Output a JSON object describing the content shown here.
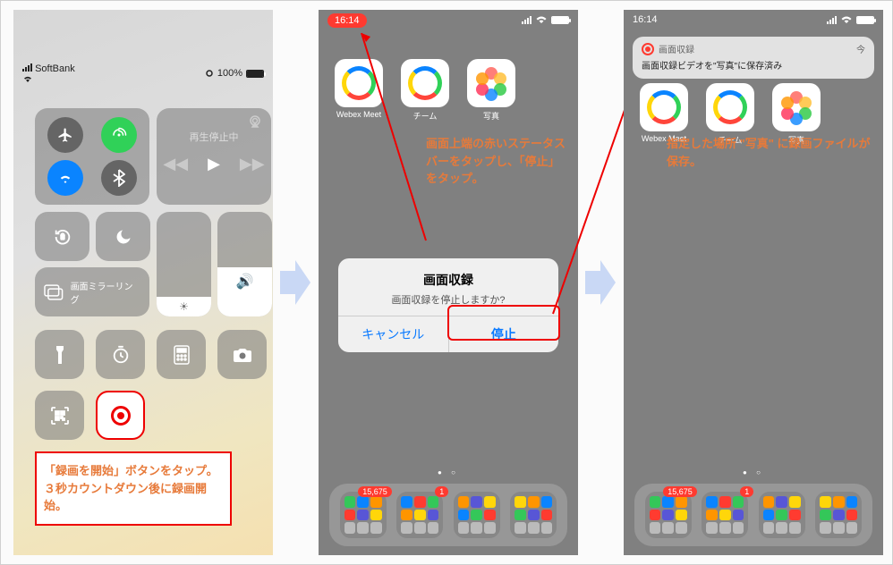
{
  "phone1": {
    "status": {
      "carrier": "SoftBank",
      "battery_pct": "100%"
    },
    "media_label": "再生停止中",
    "mirror_label": "画面ミラーリング",
    "note": "「録画を開始」ボタンをタップ。３秒カウントダウン後に録画開始。"
  },
  "phone2": {
    "status": {
      "time": "16:14"
    },
    "apps": [
      {
        "name": "Webex Meet",
        "kind": "ring"
      },
      {
        "name": "チーム",
        "kind": "ring"
      },
      {
        "name": "写真",
        "kind": "photos"
      }
    ],
    "note": "画面上端の赤いステータスバーをタップし、「停止」をタップ。",
    "alert": {
      "title": "画面収録",
      "message": "画面収録を停止しますか?",
      "cancel": "キャンセル",
      "stop": "停止"
    },
    "dock_badges": [
      "15,675",
      "1",
      "",
      ""
    ]
  },
  "phone3": {
    "status": {
      "time": "16:14"
    },
    "notification": {
      "app": "画面収録",
      "when": "今",
      "body": "画面収録ビデオを\"写真\"に保存済み"
    },
    "apps": [
      {
        "name": "Webex Meet",
        "kind": "ring"
      },
      {
        "name": "チーム",
        "kind": "ring"
      },
      {
        "name": "写真",
        "kind": "photos"
      }
    ],
    "note": "指定した場所 \"写真\" に録画ファイルが保存。",
    "dock_badges": [
      "15,675",
      "1",
      "",
      ""
    ]
  }
}
